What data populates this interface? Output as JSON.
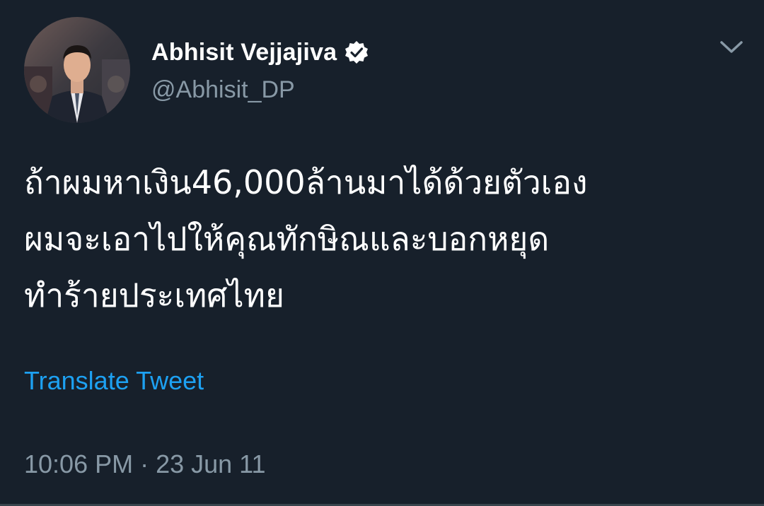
{
  "tweet": {
    "author": {
      "name": "Abhisit Vejjajiva",
      "handle": "@Abhisit_DP",
      "verified": true,
      "avatar_icon": "profile-photo"
    },
    "body": "ถ้าผมหาเงิน46,000ล้านมาได้ด้วยตัวเอง\nผมจะเอาไปให้คุณทักษิณและบอกหยุด\nทำร้ายประเทศไทย",
    "translate_label": "Translate Tweet",
    "timestamp": "10:06 PM · 23 Jun 11",
    "menu_icon": "chevron-down-icon"
  },
  "colors": {
    "background": "#17202b",
    "primary_text": "#ffffff",
    "secondary_text": "#8899a6",
    "link": "#1da1f2",
    "divider": "#38444d"
  }
}
